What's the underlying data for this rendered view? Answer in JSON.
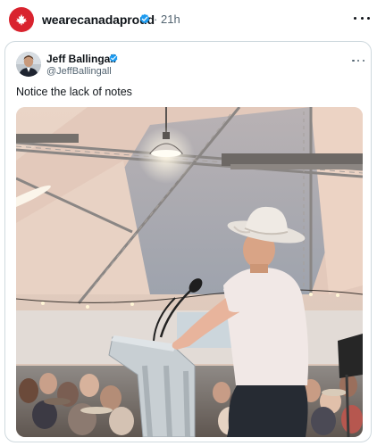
{
  "post": {
    "author_username": "wearecanadaproud",
    "separator": "·",
    "time": "21h"
  },
  "quote": {
    "display_name": "Jeff Ballingall",
    "handle": "@JeffBallingall",
    "text": "Notice the lack of notes"
  },
  "colors": {
    "brand_red": "#d9232e",
    "verified_blue": "#1d9bf0",
    "secondary_text": "#536471",
    "border": "#cfd9de"
  },
  "icons": {
    "outer_avatar": "maple-leaf-icon",
    "verified": "verified-badge-icon",
    "more": "more-dots-icon"
  }
}
